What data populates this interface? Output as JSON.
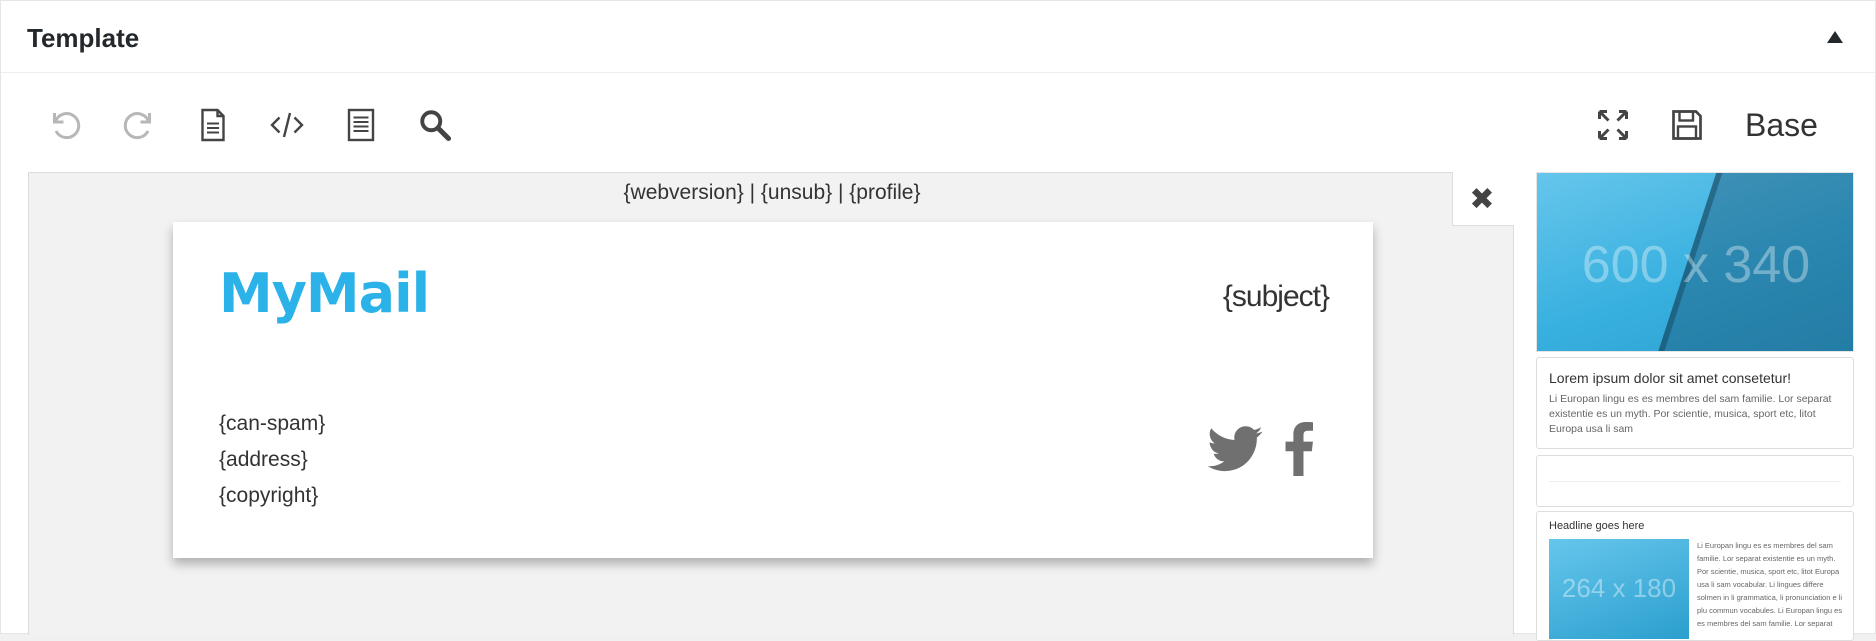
{
  "panel": {
    "title": "Template"
  },
  "toolbar": {
    "undo_icon": "undo-icon",
    "redo_icon": "redo-icon",
    "html_view_icon": "code-icon",
    "base_label": "Base"
  },
  "editor": {
    "preheader": "{webversion} | {unsub} | {profile}",
    "logo": "MyMail",
    "subject": "{subject}",
    "footer": [
      "{can-spam}",
      "{address}",
      "{copyright}"
    ]
  },
  "sidebar": {
    "image_module": {
      "dimensions": "600 x 340"
    },
    "text_module": {
      "headline": "Lorem ipsum dolor sit amet consetetur!",
      "body": "Li Europan lingu es es membres del sam familie. Lor separat existentie es un myth. Por scientie, musica, sport etc, litot Europa usa li sam"
    },
    "mixed_module": {
      "headline": "Headline goes here",
      "image_dimensions": "264 x 180",
      "body": "Li Europan lingu es es membres del sam familie. Lor separat existentie es un myth. Por scientie, musica, sport etc, litot Europa usa li sam vocabular. Li lingues differe solmen in li grammatica, li pronunciation e li plu commun vocabules. Li Europan lingu es es membres del sam familie. Lor separat"
    }
  },
  "colors": {
    "brand": "#2bb2e8",
    "text": "#333333"
  }
}
